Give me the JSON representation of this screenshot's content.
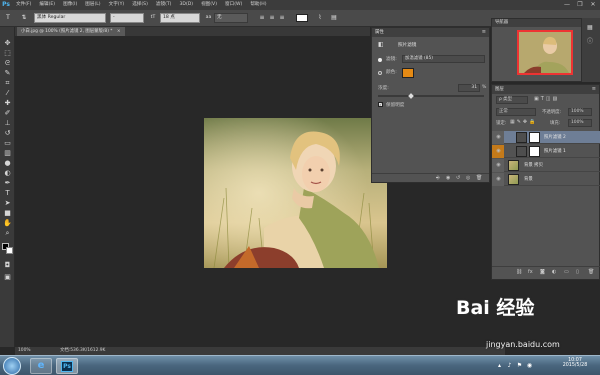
{
  "app": {
    "logo": "Ps"
  },
  "menu": [
    "文件(F)",
    "编辑(E)",
    "图像(I)",
    "图层(L)",
    "文字(Y)",
    "选择(S)",
    "滤镜(T)",
    "3D(D)",
    "视图(V)",
    "窗口(W)",
    "帮助(H)"
  ],
  "window_controls": {
    "minimize": "—",
    "restore": "❐",
    "close": "✕"
  },
  "options": {
    "tool_icon": "T",
    "font_family": "黑体 Regular",
    "font_style": "-",
    "size_icon": "tT",
    "size": "18 点",
    "aa_icon": "aa",
    "aa_mode": "无"
  },
  "document": {
    "tab_label": "小白.jpg @ 100% (照片滤镜 2, 图层蒙版/8) *",
    "tab_close": "×"
  },
  "properties": {
    "tab_label": "属性",
    "adjustment_name": "照片滤镜",
    "filter_label": "滤镜:",
    "filter_value": "加温滤镜 (85)",
    "color_label": "颜色:",
    "color_hex": "#e58a14",
    "density_label": "浓度:",
    "density_value": "31",
    "density_unit": "%",
    "preserve_label": "保留明度",
    "preserve_checked": "✓"
  },
  "navigator": {
    "tab_label": "导航器"
  },
  "layers": {
    "tab_label": "图层",
    "kind_filter": "ρ 类型",
    "blend_mode": "正常",
    "opacity_label": "不透明度:",
    "opacity_value": "100%",
    "lock_label": "锁定:",
    "fill_label": "填充:",
    "fill_value": "100%",
    "items": [
      {
        "name": "照片滤镜 2",
        "selected": true,
        "eye_color": "#5f5f5f"
      },
      {
        "name": "照片滤镜 1",
        "selected": false,
        "eye_color": "#c47a1a"
      },
      {
        "name": "背景 拷贝",
        "selected": false,
        "eye_color": "#5f5f5f"
      },
      {
        "name": "背景",
        "selected": false,
        "eye_color": "#5f5f5f"
      }
    ]
  },
  "status": {
    "zoom": "100%",
    "doc_info": "文档:536.3K/1612.9K"
  },
  "taskbar": {
    "clock_time": "10:07",
    "clock_date": "2015/5/28",
    "ps_label": "Ps"
  },
  "watermark": {
    "brand": "Bai 经验",
    "url": "jingyan.baidu.com"
  },
  "colors": {
    "accent_blue": "#4fb6f0",
    "panel_bg": "#535353",
    "workspace": "#282828"
  }
}
